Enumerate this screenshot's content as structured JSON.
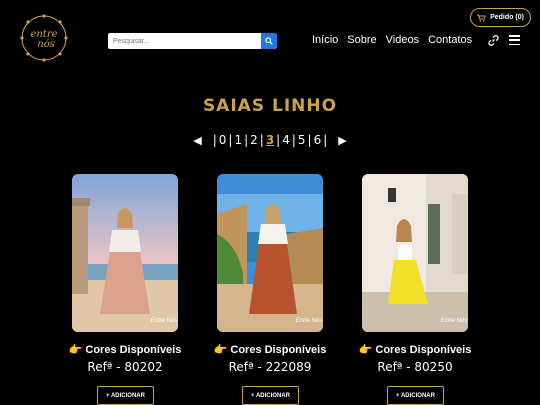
{
  "header": {
    "logo_text": "entre nós",
    "order_button": "Pedido (0)",
    "search_placeholder": "Pesquisar...",
    "nav": [
      "Início",
      "Sobre",
      "Videos",
      "Contatos"
    ]
  },
  "section": {
    "title": "SAIAS LINHO",
    "pagination": {
      "pages": [
        "0",
        "1",
        "2",
        "3",
        "4",
        "5",
        "6"
      ],
      "active": "3",
      "prev_symbol": "◀",
      "next_symbol": "▶"
    }
  },
  "products": [
    {
      "caption": "👉 Cores Disponíveis",
      "ref": "Refª - 80202",
      "button": "+ ADICIONAR",
      "watermark": "Entre Nós"
    },
    {
      "caption": "👉 Cores Disponíveis",
      "ref": "Refª - 222089",
      "button": "+ ADICIONAR",
      "watermark": "Entre Nós"
    },
    {
      "caption": "👉 Cores Disponíveis",
      "ref": "Refª - 80250",
      "button": "+ ADICIONAR",
      "watermark": "Entre Nós"
    }
  ],
  "colors": {
    "accent": "#c9a34a",
    "search_button": "#1f7ae0",
    "background": "#000000"
  }
}
